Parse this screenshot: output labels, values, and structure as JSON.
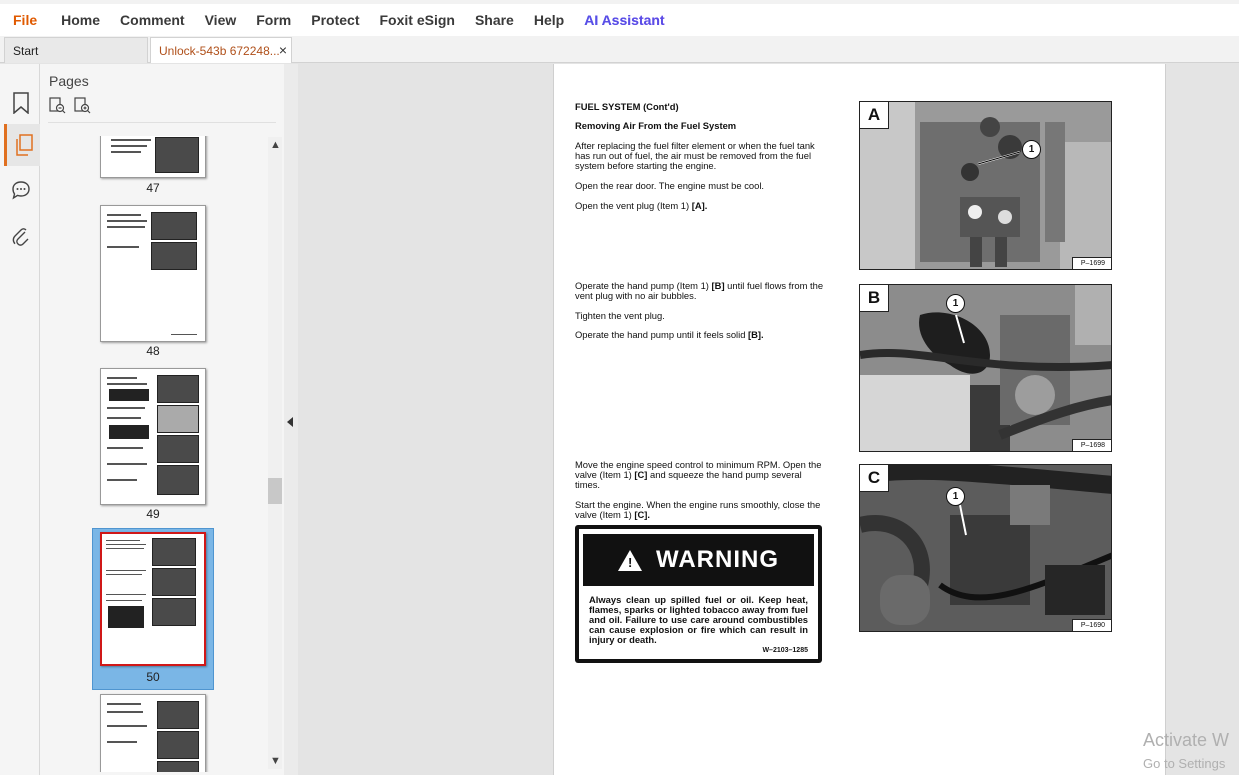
{
  "menu": {
    "file": "File",
    "home": "Home",
    "comment": "Comment",
    "view": "View",
    "form": "Form",
    "protect": "Protect",
    "esign": "Foxit eSign",
    "share": "Share",
    "help": "Help",
    "ai": "AI Assistant"
  },
  "tabs": {
    "start": "Start",
    "document": "Unlock-543b 672248...",
    "close": "×"
  },
  "pages_panel": {
    "title": "Pages",
    "thumbnails": [
      {
        "label": "47"
      },
      {
        "label": "48"
      },
      {
        "label": "49"
      },
      {
        "label": "50",
        "selected": true
      }
    ]
  },
  "document": {
    "heading": "FUEL SYSTEM (Cont'd)",
    "subheading": "Removing Air From the Fuel System",
    "para1": "After replacing the fuel filter element or when the fuel tank has run out of fuel, the air must be removed from the fuel system before starting the engine.",
    "para2": "Open the rear door. The engine must be cool.",
    "para3_text": "Open the vent plug (Item 1) ",
    "para3_ref": "[A].",
    "para4_text_a": "Operate the hand pump (Item 1) ",
    "para4_ref": "[B]",
    "para4_text_b": " until fuel flows from the vent plug with no air bubbles.",
    "para5": "Tighten the vent plug.",
    "para6_text": "Operate the hand pump until it feels solid ",
    "para6_ref": "[B].",
    "para7_text_a": "Move the engine speed control to minimum RPM. Open the valve (Item 1) ",
    "para7_ref": "[C]",
    "para7_text_b": " and squeeze the hand pump several times.",
    "para8_text": "Start the engine. When the engine runs smoothly, close the valve (Item 1) ",
    "para8_ref": "[C].",
    "warning_title": "WARNING",
    "warning_body": "Always clean up spilled fuel or oil. Keep heat, flames, sparks or lighted tobacco away from fuel and oil. Failure to use care around combustibles can cause explosion or fire which can result in injury or death.",
    "warning_code": "W–2103–1285",
    "figures": [
      {
        "letter": "A",
        "code": "P–1699",
        "callout": "1"
      },
      {
        "letter": "B",
        "code": "P–1698",
        "callout": "1"
      },
      {
        "letter": "C",
        "code": "P–1690",
        "callout": "1"
      }
    ]
  },
  "watermark": {
    "line1": "Activate W",
    "line2": "Go to Settings"
  }
}
